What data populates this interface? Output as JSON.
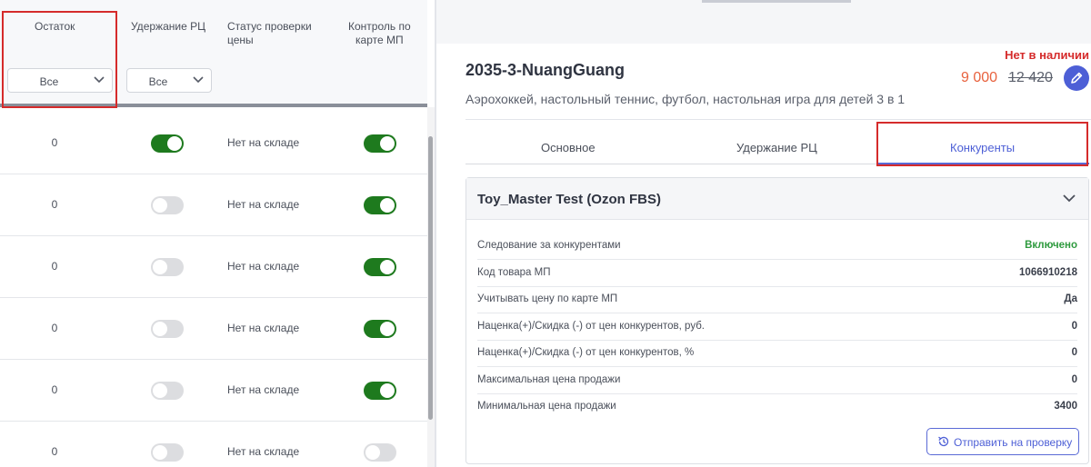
{
  "table": {
    "headers": {
      "remainder": "Остаток",
      "hold_rc": "Удержание РЦ",
      "price_check_status_line1": "Статус проверки",
      "price_check_status_line2": "цены",
      "mp_card_control_line1": "Контроль по",
      "mp_card_control_line2": "карте МП"
    },
    "filters": {
      "remainder": "Все",
      "hold_rc": "Все"
    },
    "rows": [
      {
        "qty": "0",
        "hold_rc": true,
        "status": "Нет на складе",
        "mp_control": true
      },
      {
        "qty": "0",
        "hold_rc": false,
        "status": "Нет на складе",
        "mp_control": true
      },
      {
        "qty": "0",
        "hold_rc": false,
        "status": "Нет на складе",
        "mp_control": true
      },
      {
        "qty": "0",
        "hold_rc": false,
        "status": "Нет на складе",
        "mp_control": true
      },
      {
        "qty": "0",
        "hold_rc": false,
        "status": "Нет на складе",
        "mp_control": true
      },
      {
        "qty": "0",
        "hold_rc": false,
        "status": "Нет на складе",
        "mp_control": false
      }
    ]
  },
  "product": {
    "sku": "2035-3-NuangGuang",
    "description": "Аэрохоккей, настольный теннис, футбол, настольная игра для детей 3 в 1",
    "availability": "Нет в наличии",
    "price": "9 000",
    "old_price": "12 420"
  },
  "tabs": [
    {
      "label": "Основное",
      "active": false
    },
    {
      "label": "Удержание РЦ",
      "active": false
    },
    {
      "label": "Конкуренты",
      "active": true
    }
  ],
  "competitor_card": {
    "title": "Toy_Master Test (Ozon FBS)",
    "rows": [
      {
        "label": "Следование за конкурентами",
        "value": "Включено"
      },
      {
        "label": "Код товара МП",
        "value": "1066910218"
      },
      {
        "label": "Учитывать цену по карте МП",
        "value": "Да"
      },
      {
        "label": "Наценка(+)/Скидка (-) от цен конкурентов, руб.",
        "value": "0"
      },
      {
        "label": "Наценка(+)/Скидка (-) от цен конкурентов, %",
        "value": "0"
      },
      {
        "label": "Максимальная цена продажи",
        "value": "0"
      },
      {
        "label": "Минимальная цена продажи",
        "value": "3400"
      }
    ],
    "send_button": "Отправить на проверку"
  },
  "colors": {
    "toggle_on": "#1e7a1e",
    "toggle_off": "#dcdde0",
    "accent": "#4d5fd6",
    "highlight_box": "#d52b2b",
    "price": "#e8623e",
    "enabled_value": "#2e9a3e"
  },
  "icons": [
    "chevron-down-icon",
    "pencil-icon",
    "history-icon"
  ]
}
